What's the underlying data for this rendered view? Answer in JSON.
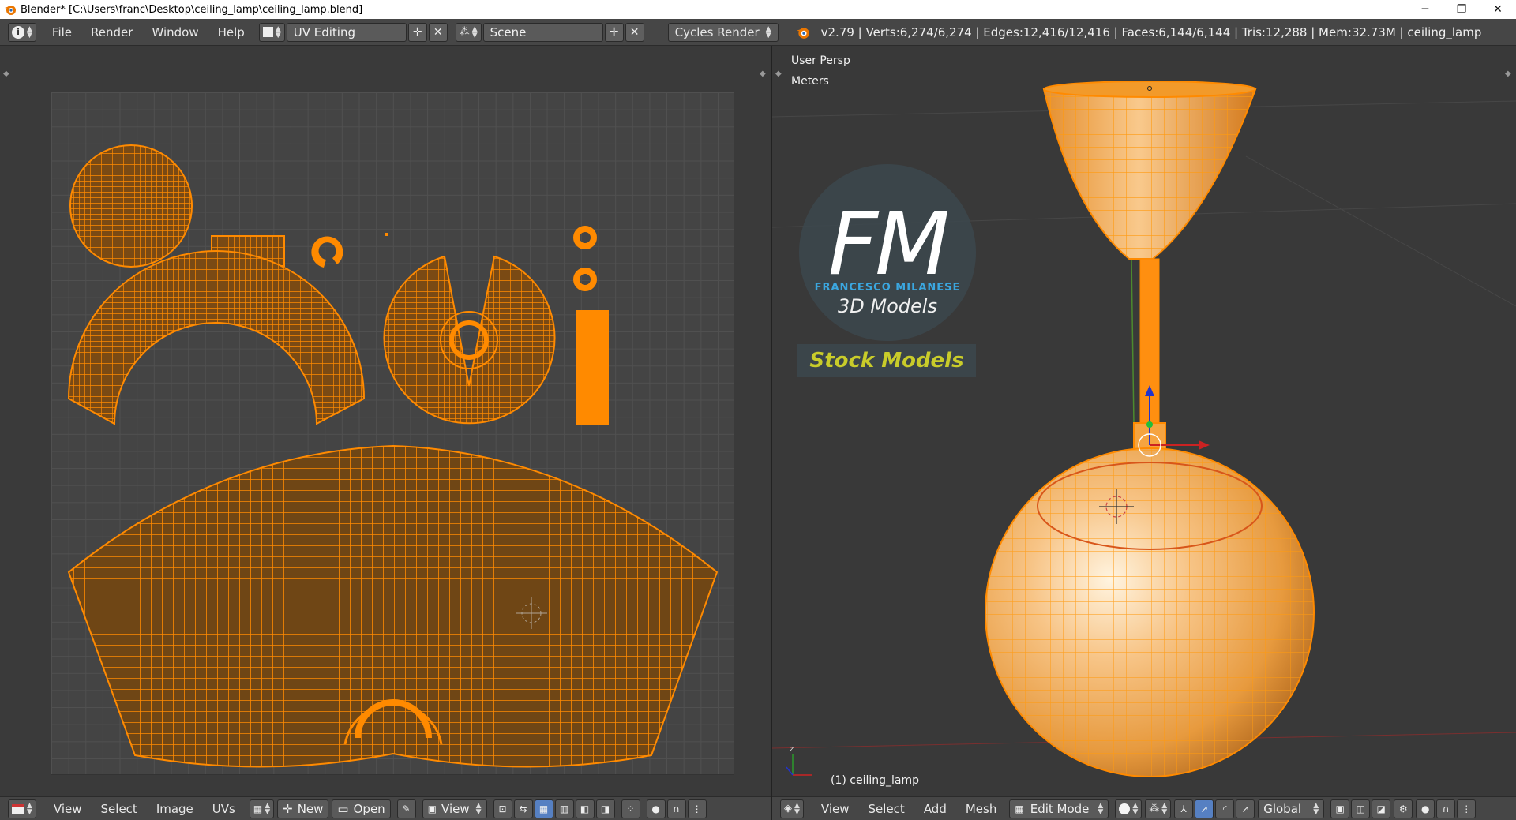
{
  "window": {
    "title": "Blender* [C:\\Users\\franc\\Desktop\\ceiling_lamp\\ceiling_lamp.blend]",
    "minimize": "─",
    "maximize": "❐",
    "close": "✕"
  },
  "topbar": {
    "menus": [
      "File",
      "Render",
      "Window",
      "Help"
    ],
    "layout": "UV Editing",
    "scene": "Scene",
    "engine": "Cycles Render",
    "status": "v2.79 | Verts:6,274/6,274 | Edges:12,416/12,416 | Faces:6,144/6,144 | Tris:12,288 | Mem:32.73M | ceiling_lamp"
  },
  "viewport": {
    "view_name": "User Persp",
    "units": "Meters",
    "object_label": "(1) ceiling_lamp",
    "watermark": {
      "logo": "FM",
      "brand": "FRANCESCO MILANESE",
      "sub": "3D Models",
      "tag": "Stock Models"
    }
  },
  "uv_footer": {
    "menus": [
      "View",
      "Select",
      "Image",
      "UVs"
    ],
    "new_label": "New",
    "open_label": "Open",
    "view_label": "View"
  },
  "vp_footer": {
    "menus": [
      "View",
      "Select",
      "Add",
      "Mesh"
    ],
    "mode": "Edit Mode",
    "orientation": "Global"
  },
  "colors": {
    "mesh": "#ff8a00",
    "accent": "#5680c2",
    "logo_blue": "#3ba7e0",
    "tag_yellow": "#c9cc2a"
  }
}
